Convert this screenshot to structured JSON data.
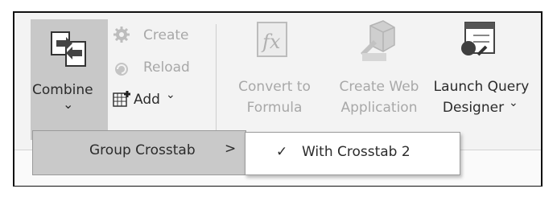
{
  "ribbon": {
    "combine": {
      "label": "Combine",
      "chevron": "⌄",
      "icon": "combine-icon"
    },
    "small_buttons": [
      {
        "label": "Create",
        "icon": "create-icon",
        "enabled": false
      },
      {
        "label": "Reload",
        "icon": "reload-icon",
        "enabled": false
      },
      {
        "label": "Add",
        "chevron": "⌄",
        "icon": "add-icon",
        "enabled": true
      }
    ],
    "convert": {
      "line1": "Convert to",
      "line2": "Formula",
      "icon": "formula-icon",
      "enabled": false
    },
    "create_web": {
      "line1": "Create Web",
      "line2": "Application",
      "icon": "web-app-icon",
      "enabled": false
    },
    "launch_query": {
      "line1": "Launch Query",
      "line2": "Designer",
      "chevron": "⌄",
      "icon": "query-designer-icon",
      "enabled": true
    }
  },
  "menu": {
    "group_crosstab": {
      "label": "Group Crosstab",
      "arrow": ">"
    },
    "flyout": {
      "check": "✓",
      "label": "With Crosstab 2",
      "checked": true
    }
  },
  "colors": {
    "selected_bg": "#c8c8c8",
    "disabled_text": "#a8a8a8",
    "ribbon_bg": "#f3f3f3"
  }
}
